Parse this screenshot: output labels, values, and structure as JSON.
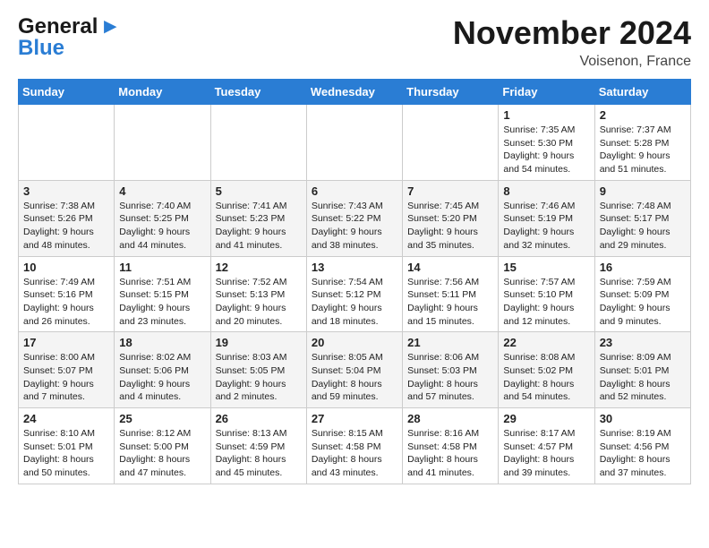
{
  "header": {
    "logo_line1": "General",
    "logo_line2": "Blue",
    "month": "November 2024",
    "location": "Voisenon, France"
  },
  "weekdays": [
    "Sunday",
    "Monday",
    "Tuesday",
    "Wednesday",
    "Thursday",
    "Friday",
    "Saturday"
  ],
  "weeks": [
    [
      {
        "day": "",
        "info": ""
      },
      {
        "day": "",
        "info": ""
      },
      {
        "day": "",
        "info": ""
      },
      {
        "day": "",
        "info": ""
      },
      {
        "day": "",
        "info": ""
      },
      {
        "day": "1",
        "info": "Sunrise: 7:35 AM\nSunset: 5:30 PM\nDaylight: 9 hours and 54 minutes."
      },
      {
        "day": "2",
        "info": "Sunrise: 7:37 AM\nSunset: 5:28 PM\nDaylight: 9 hours and 51 minutes."
      }
    ],
    [
      {
        "day": "3",
        "info": "Sunrise: 7:38 AM\nSunset: 5:26 PM\nDaylight: 9 hours and 48 minutes."
      },
      {
        "day": "4",
        "info": "Sunrise: 7:40 AM\nSunset: 5:25 PM\nDaylight: 9 hours and 44 minutes."
      },
      {
        "day": "5",
        "info": "Sunrise: 7:41 AM\nSunset: 5:23 PM\nDaylight: 9 hours and 41 minutes."
      },
      {
        "day": "6",
        "info": "Sunrise: 7:43 AM\nSunset: 5:22 PM\nDaylight: 9 hours and 38 minutes."
      },
      {
        "day": "7",
        "info": "Sunrise: 7:45 AM\nSunset: 5:20 PM\nDaylight: 9 hours and 35 minutes."
      },
      {
        "day": "8",
        "info": "Sunrise: 7:46 AM\nSunset: 5:19 PM\nDaylight: 9 hours and 32 minutes."
      },
      {
        "day": "9",
        "info": "Sunrise: 7:48 AM\nSunset: 5:17 PM\nDaylight: 9 hours and 29 minutes."
      }
    ],
    [
      {
        "day": "10",
        "info": "Sunrise: 7:49 AM\nSunset: 5:16 PM\nDaylight: 9 hours and 26 minutes."
      },
      {
        "day": "11",
        "info": "Sunrise: 7:51 AM\nSunset: 5:15 PM\nDaylight: 9 hours and 23 minutes."
      },
      {
        "day": "12",
        "info": "Sunrise: 7:52 AM\nSunset: 5:13 PM\nDaylight: 9 hours and 20 minutes."
      },
      {
        "day": "13",
        "info": "Sunrise: 7:54 AM\nSunset: 5:12 PM\nDaylight: 9 hours and 18 minutes."
      },
      {
        "day": "14",
        "info": "Sunrise: 7:56 AM\nSunset: 5:11 PM\nDaylight: 9 hours and 15 minutes."
      },
      {
        "day": "15",
        "info": "Sunrise: 7:57 AM\nSunset: 5:10 PM\nDaylight: 9 hours and 12 minutes."
      },
      {
        "day": "16",
        "info": "Sunrise: 7:59 AM\nSunset: 5:09 PM\nDaylight: 9 hours and 9 minutes."
      }
    ],
    [
      {
        "day": "17",
        "info": "Sunrise: 8:00 AM\nSunset: 5:07 PM\nDaylight: 9 hours and 7 minutes."
      },
      {
        "day": "18",
        "info": "Sunrise: 8:02 AM\nSunset: 5:06 PM\nDaylight: 9 hours and 4 minutes."
      },
      {
        "day": "19",
        "info": "Sunrise: 8:03 AM\nSunset: 5:05 PM\nDaylight: 9 hours and 2 minutes."
      },
      {
        "day": "20",
        "info": "Sunrise: 8:05 AM\nSunset: 5:04 PM\nDaylight: 8 hours and 59 minutes."
      },
      {
        "day": "21",
        "info": "Sunrise: 8:06 AM\nSunset: 5:03 PM\nDaylight: 8 hours and 57 minutes."
      },
      {
        "day": "22",
        "info": "Sunrise: 8:08 AM\nSunset: 5:02 PM\nDaylight: 8 hours and 54 minutes."
      },
      {
        "day": "23",
        "info": "Sunrise: 8:09 AM\nSunset: 5:01 PM\nDaylight: 8 hours and 52 minutes."
      }
    ],
    [
      {
        "day": "24",
        "info": "Sunrise: 8:10 AM\nSunset: 5:01 PM\nDaylight: 8 hours and 50 minutes."
      },
      {
        "day": "25",
        "info": "Sunrise: 8:12 AM\nSunset: 5:00 PM\nDaylight: 8 hours and 47 minutes."
      },
      {
        "day": "26",
        "info": "Sunrise: 8:13 AM\nSunset: 4:59 PM\nDaylight: 8 hours and 45 minutes."
      },
      {
        "day": "27",
        "info": "Sunrise: 8:15 AM\nSunset: 4:58 PM\nDaylight: 8 hours and 43 minutes."
      },
      {
        "day": "28",
        "info": "Sunrise: 8:16 AM\nSunset: 4:58 PM\nDaylight: 8 hours and 41 minutes."
      },
      {
        "day": "29",
        "info": "Sunrise: 8:17 AM\nSunset: 4:57 PM\nDaylight: 8 hours and 39 minutes."
      },
      {
        "day": "30",
        "info": "Sunrise: 8:19 AM\nSunset: 4:56 PM\nDaylight: 8 hours and 37 minutes."
      }
    ]
  ]
}
